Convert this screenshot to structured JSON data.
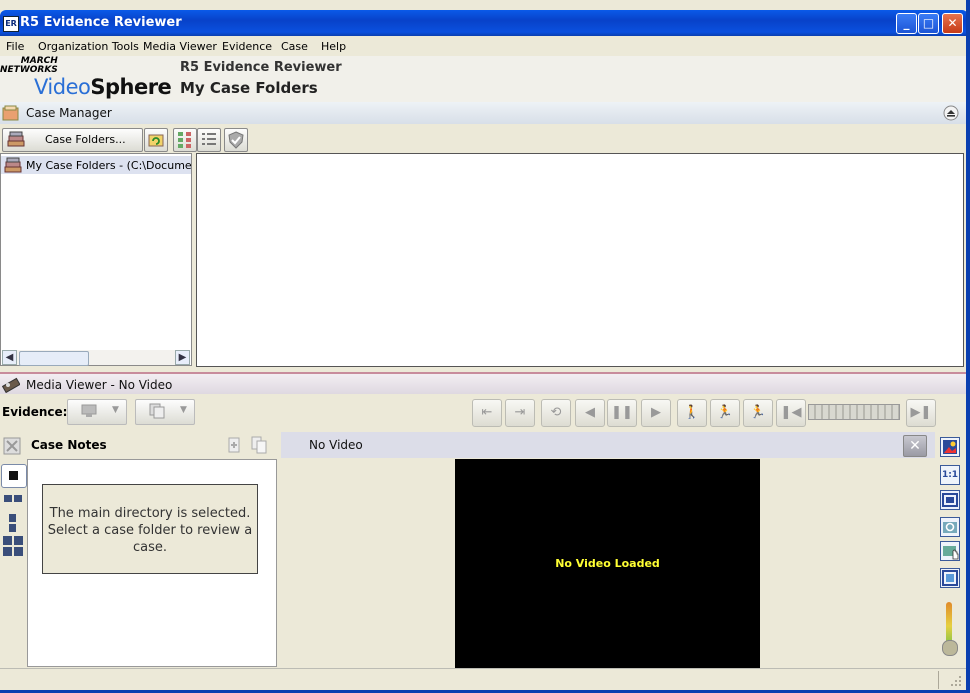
{
  "window": {
    "icon_text": "ER",
    "title": "R5 Evidence Reviewer",
    "controls": [
      "_",
      "□",
      "✕"
    ]
  },
  "menu": [
    "File",
    "Organization Tools",
    "Media Viewer",
    "Evidence",
    "Case",
    "Help"
  ],
  "header": {
    "logo_line1": "MARCH",
    "logo_line2": "NETWORKS",
    "logo_video": "Video",
    "logo_sphere": "Sphere",
    "app_name": "R5 Evidence Reviewer",
    "section": "My Case Folders"
  },
  "case_manager": {
    "title": "Case Manager",
    "case_folders_button": "Case Folders...",
    "tree_item": "My Case Folders - (C:\\Documents"
  },
  "media_viewer": {
    "title": "Media Viewer - No Video",
    "evidence_label": "Evidence:"
  },
  "case_notes": {
    "title": "Case Notes",
    "message": "The main directory is selected. Select a case folder to review a case."
  },
  "video": {
    "header": "No Video",
    "message": "No Video Loaded"
  },
  "colors": {
    "titlebar": "#0a50df",
    "video_text": "#ffff33",
    "accent_green": "#a8cfc0",
    "accent_pink": "#c88c9c"
  }
}
